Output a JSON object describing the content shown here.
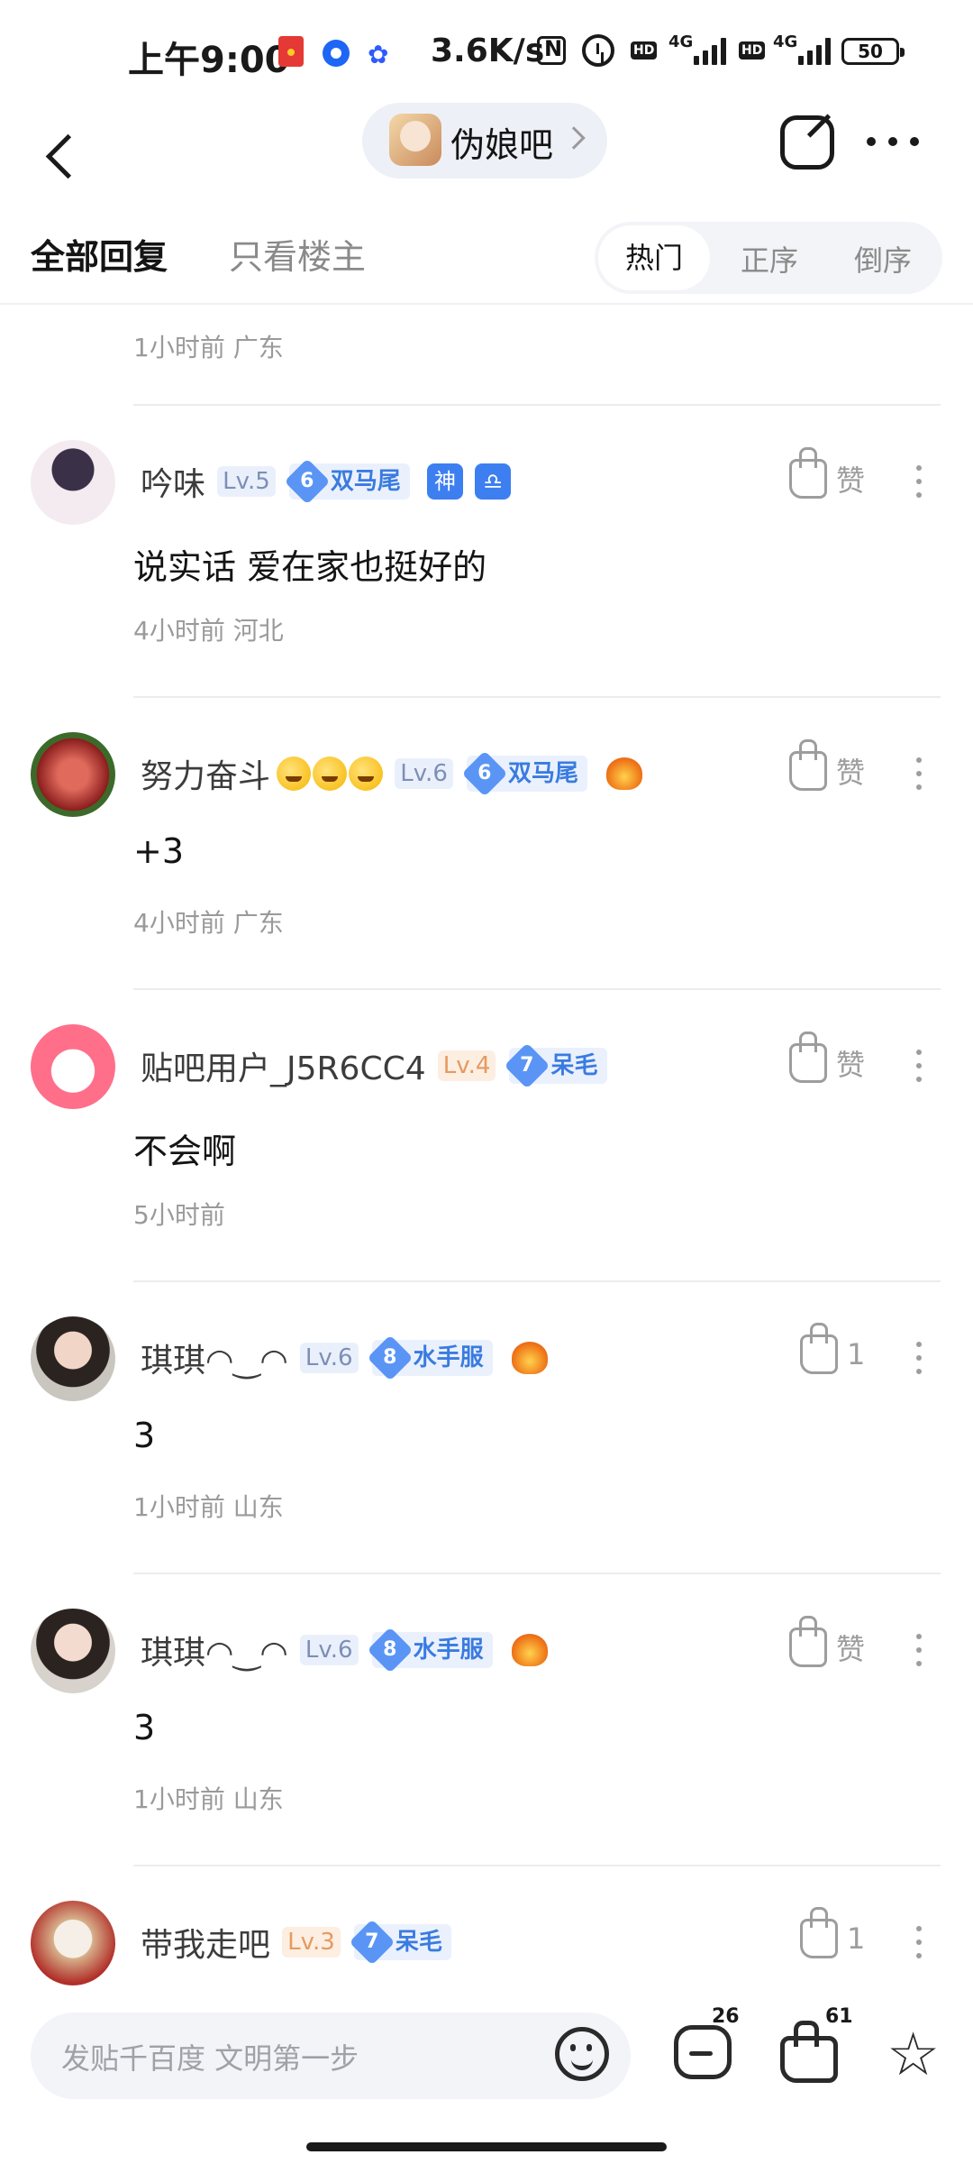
{
  "status_bar": {
    "time": "上午9:00",
    "speed": "3.6K/s",
    "hd1": "HD",
    "net1": "4G",
    "hd2": "HD",
    "net2": "4G",
    "battery": "50"
  },
  "nav": {
    "forum_name": "伪娘吧"
  },
  "tabs": {
    "all": "全部回复",
    "host_only": "只看楼主",
    "sort_hot": "热门",
    "sort_asc": "正序",
    "sort_desc": "倒序"
  },
  "top_meta": "1小时前  广东",
  "comments": [
    {
      "username": "吟味",
      "level": "Lv.5",
      "badge_num": "6",
      "badge": "双马尾",
      "extra": [
        "神",
        "♎"
      ],
      "like": "赞",
      "content": "说实话 爱在家也挺好的",
      "meta": "4小时前  河北"
    },
    {
      "username": "努力奋斗",
      "level": "Lv.6",
      "badge_num": "6",
      "badge": "双马尾",
      "like": "赞",
      "content": "+3",
      "meta": "4小时前  广东"
    },
    {
      "username": "贴吧用户_J5R6CC4",
      "level": "Lv.4",
      "badge_num": "7",
      "badge": "呆毛",
      "like": "赞",
      "content": "不会啊",
      "meta": "5小时前"
    },
    {
      "username": "琪琪◠‿◠",
      "level": "Lv.6",
      "badge_num": "8",
      "badge": "水手服",
      "like": "1",
      "content": "3",
      "meta": "1小时前  山东"
    },
    {
      "username": "琪琪◠‿◠",
      "level": "Lv.6",
      "badge_num": "8",
      "badge": "水手服",
      "like": "赞",
      "content": "3",
      "meta": "1小时前  山东"
    },
    {
      "username": "带我走吧",
      "level": "Lv.3",
      "badge_num": "7",
      "badge": "呆毛",
      "like": "1"
    }
  ],
  "bottom_bar": {
    "placeholder": "发贴千百度 文明第一步",
    "comment_count": "26",
    "like_count": "61"
  },
  "colors": {
    "accent_blue": "#3a7be0",
    "badge_bg": "#eaf1fd",
    "muted_text": "#9a9a9a"
  },
  "icons": [
    "back-icon",
    "chevron-right-icon",
    "share-icon",
    "more-icon",
    "thumb-up-icon",
    "kebab-icon",
    "smile-icon",
    "comment-icon",
    "star-icon"
  ]
}
